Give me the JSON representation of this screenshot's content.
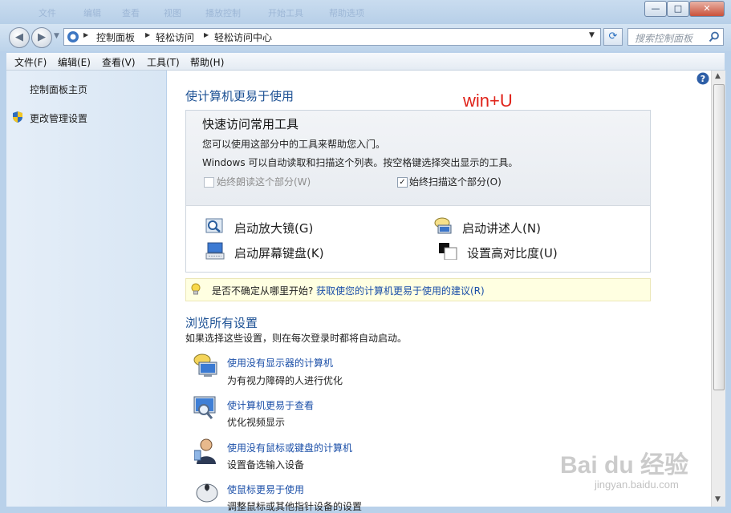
{
  "titlebar": {
    "ghost_tabs": [
      "文件",
      "编辑",
      "查看",
      "视图",
      "播放控制",
      "开始工具",
      "帮助选项"
    ],
    "minimize": "—",
    "maximize": "□",
    "close": "✕"
  },
  "nav": {
    "back": "◀",
    "forward": "▶",
    "breadcrumb": [
      "控制面板",
      "轻松访问",
      "轻松访问中心"
    ],
    "search_placeholder": "搜索控制面板"
  },
  "menu": [
    "文件(F)",
    "编辑(E)",
    "查看(V)",
    "工具(T)",
    "帮助(H)"
  ],
  "sidebar": {
    "home": "控制面板主页",
    "admin": "更改管理设置"
  },
  "main": {
    "title": "使计算机更易于使用",
    "annotation": "win+U",
    "quick": {
      "title": "快速访问常用工具",
      "desc1": "您可以使用这部分中的工具来帮助您入门。",
      "desc2": "Windows 可以自动读取和扫描这个列表。按空格键选择突出显示的工具。",
      "always_read": "始终朗读这个部分(W)",
      "always_read_checked": false,
      "always_scan": "始终扫描这个部分(O)",
      "always_scan_checked": true,
      "tools": [
        "启动放大镜(G)",
        "启动讲述人(N)",
        "启动屏幕键盘(K)",
        "设置高对比度(U)"
      ]
    },
    "tip": {
      "text": "是否不确定从哪里开始?",
      "link": "获取使您的计算机更易于使用的建议(R)"
    },
    "browse": {
      "title": "浏览所有设置",
      "desc": "如果选择这些设置，则在每次登录时都将自动启动。",
      "items": [
        {
          "link": "使用没有显示器的计算机",
          "sub": "为有视力障碍的人进行优化"
        },
        {
          "link": "使计算机更易于查看",
          "sub": "优化视频显示"
        },
        {
          "link": "使用没有鼠标或键盘的计算机",
          "sub": "设置备选输入设备"
        },
        {
          "link": "使鼠标更易于使用",
          "sub": "调整鼠标或其他指针设备的设置"
        }
      ]
    }
  },
  "watermark": {
    "brand": "Bai du 经验",
    "url": "jingyan.baidu.com"
  },
  "colors": {
    "accent": "#1d5194",
    "link": "#1b4fa8",
    "annotation": "#e0241b",
    "tip_bg": "#ffffe1"
  }
}
